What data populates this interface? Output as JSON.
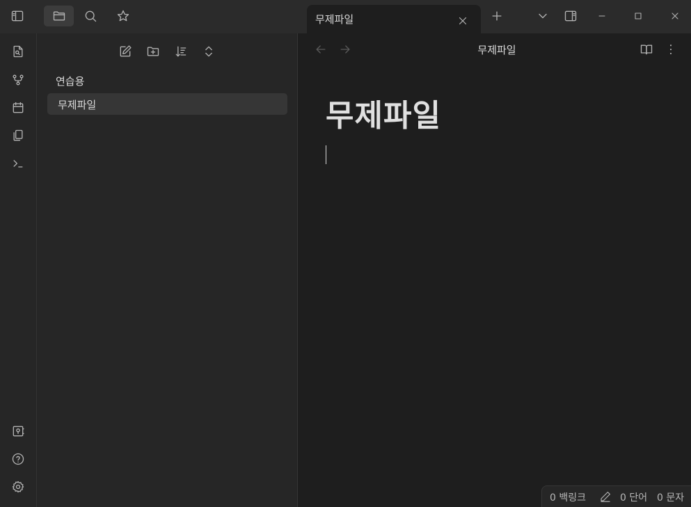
{
  "topbar": {
    "icons": {
      "sidebar_toggle": "sidebar-left-icon",
      "files": "folder-icon",
      "search": "search-icon",
      "bookmarks": "star-icon",
      "new_tab": "plus-icon",
      "tab_list": "chevron-down-icon",
      "right_sidebar": "sidebar-right-icon",
      "minimize": "minimize-icon",
      "maximize": "maximize-icon",
      "close": "close-icon"
    }
  },
  "tab": {
    "title": "무제파일"
  },
  "ribbon": {
    "items": [
      "file-search-icon",
      "graph-icon",
      "calendar-icon",
      "copy-icon",
      "terminal-icon"
    ],
    "bottom": [
      "vault-icon",
      "help-icon",
      "settings-icon"
    ]
  },
  "explorer": {
    "toolbar": [
      "new-note-icon",
      "new-folder-icon",
      "sort-icon",
      "collapse-icon"
    ],
    "folder": "연습용",
    "files": [
      {
        "label": "무제파일",
        "active": true
      }
    ]
  },
  "editor": {
    "view_title": "무제파일",
    "heading": "무제파일"
  },
  "statusbar": {
    "backlinks": "0 백링크",
    "words": "0 단어",
    "chars": "0 문자"
  },
  "colors": {
    "background": "#1e1e1e",
    "panel": "#262626",
    "topbar": "#2b2b2b",
    "active_item": "#363636"
  }
}
